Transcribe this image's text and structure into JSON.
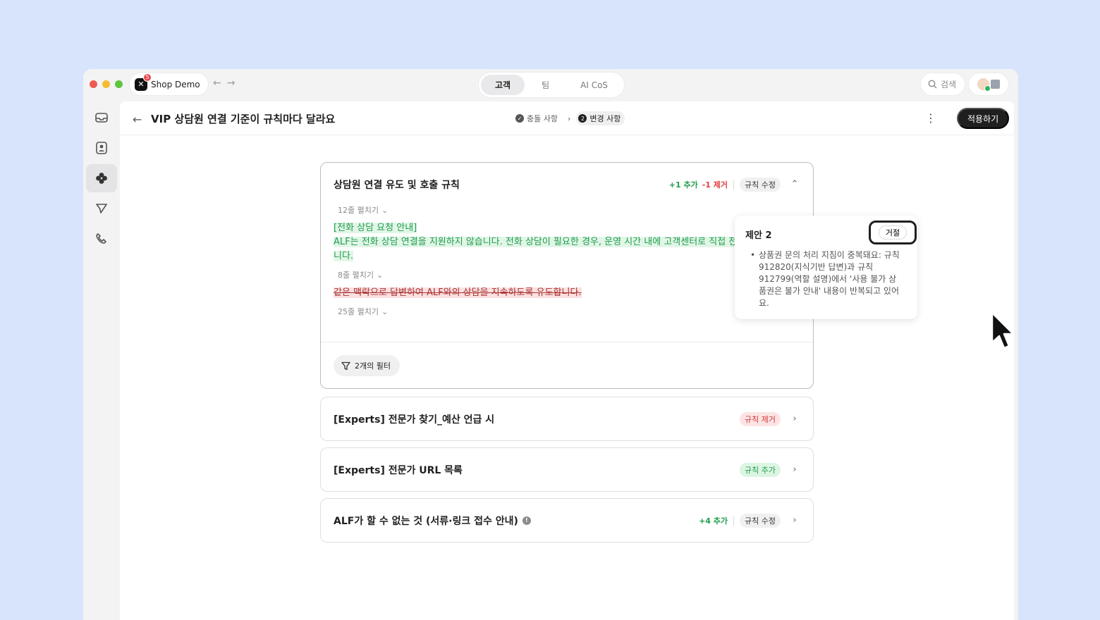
{
  "titlebar": {
    "app_name": "Shop Demo",
    "badge_count": "5",
    "tabs": [
      "고객",
      "팀",
      "AI CoS"
    ],
    "active_tab": "고객",
    "search_label": "검색"
  },
  "sidebar": {
    "items": [
      "inbox-icon",
      "contacts-icon",
      "clover-icon",
      "send-icon",
      "phone-icon"
    ],
    "active": "clover-icon"
  },
  "header": {
    "title": "VIP 상담원 연결 기준이 규칙마다 달라요",
    "steps": [
      {
        "label": "충돌 사항",
        "done": true
      },
      {
        "label": "변경 사항",
        "number": "2",
        "active": true
      }
    ],
    "apply_label": "적용하기"
  },
  "rules": {
    "expanded": {
      "title": "상담원 연결 유도 및 호출 규칙",
      "added": "+1 추가",
      "removed": "-1 제거",
      "tag": "규칙 수정",
      "expand_1": "12줄 펼치기",
      "added_line_1": "[전화 상담 요청 안내]",
      "added_line_2": "ALF는 전화 상담 연결을 지원하지 않습니다. 전화 상담이 필요한 경우, 운영 시간 내에 고객센터로 직접 전화하도록 안내합니다.",
      "expand_2": "8줄 펼치기",
      "removed_line": "같은 맥락으로 답변하여 ALF와의 상담을 지속하도록 유도합니다.",
      "expand_3": "25줄 펼치기",
      "filter_label": "2개의 필터"
    },
    "collapsed": [
      {
        "title": "[Experts] 전문가 찾기_예산 언급 시",
        "tag": "규칙 제거"
      },
      {
        "title": "[Experts] 전문가 URL 목록",
        "tag": "규칙 추가"
      },
      {
        "title": "ALF가 할 수 없는 것 (서류·링크 접수 안내)",
        "added": "+4 추가",
        "tag": "규칙 수정"
      }
    ]
  },
  "suggestion": {
    "title": "제안 2",
    "reject_label": "거절",
    "body": "상품권 문의 처리 지침이 중복돼요: 규칙 912820(지식기반 답변)과 규칙 912799(역할 설명)에서 '사용 불가 상품권은 불가 안내' 내용이 반복되고 있어요."
  }
}
